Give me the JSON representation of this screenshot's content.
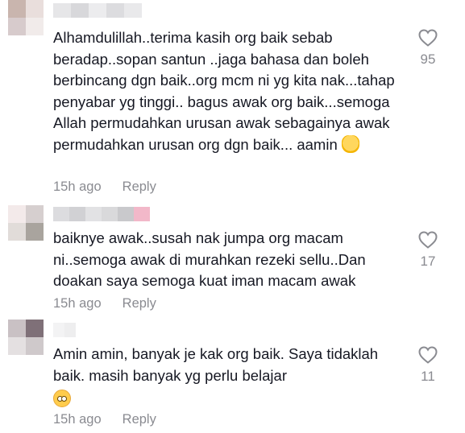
{
  "comments": [
    {
      "text": "Alhamdulillah..terima kasih org baik sebab beradap..sopan santun ..jaga bahasa dan boleh berbincang dgn baik..org mcm ni yg kita nak...tahap penyabar yg tinggi.. bagus awak org baik...semoga Allah permudahkan urusan awak sebagainya awak permudahkan urusan org dgn baik... aamin",
      "emoji": "folded-hands-emoji",
      "time": "15h ago",
      "reply": "Reply",
      "likes": "95",
      "avatar_colors": [
        "#c9b5ae",
        "#e9dedc",
        "#d7cbcc",
        "#f1ebea"
      ],
      "username_colors": [
        "#e6e6e8",
        "#d8d8db",
        "#ececee",
        "#dcdcdf",
        "#e9e9eb"
      ]
    },
    {
      "text": "baiknye awak..susah nak jumpa org macam ni..semoga awak di murahkan rezeki sellu..Dan doakan saya semoga kuat iman macam awak",
      "time": "15h ago",
      "reply": "Reply",
      "likes": "17",
      "avatar_colors": [
        "#f3eaea",
        "#d6cfcf",
        "#e1dcd9",
        "#a9a49e"
      ],
      "username_colors": [
        "#dcdcdf",
        "#d1d1d4",
        "#e2e2e4",
        "#d9d9db",
        "#c9c9cc",
        "#f2b8c9"
      ]
    },
    {
      "text": "Amin amin, banyak je kak org baik. Saya tidaklah baik. masih banyak yg perlu belajar",
      "emoji": "smiling-face-emoji",
      "time": "15h ago",
      "reply": "Reply",
      "likes": "11",
      "avatar_colors": [
        "#c9c1c4",
        "#7f7078",
        "#e4e0e1",
        "#cfc9cb"
      ],
      "username_colors": [
        "#f3f3f4",
        "#eeeeef"
      ]
    }
  ],
  "colors": {
    "text": "#161823",
    "meta": "#8a8b91",
    "heart_stroke": "#8a8b91"
  }
}
